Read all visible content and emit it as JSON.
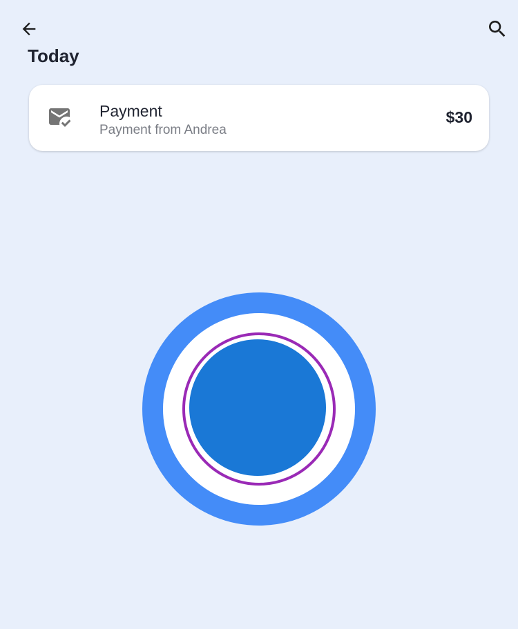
{
  "app_bar": {
    "back_icon": "arrow-back-icon",
    "search_icon": "search-icon"
  },
  "section": {
    "heading": "Today"
  },
  "transaction": {
    "icon": "mark-email-read-icon",
    "title": "Payment",
    "subtitle": "Payment from Andrea",
    "amount": "$30"
  },
  "colors": {
    "background": "#e8effb",
    "fab_outer": "#448cf8",
    "fab_ring": "#9a2ab6",
    "fab_inner": "#1a78d6"
  }
}
